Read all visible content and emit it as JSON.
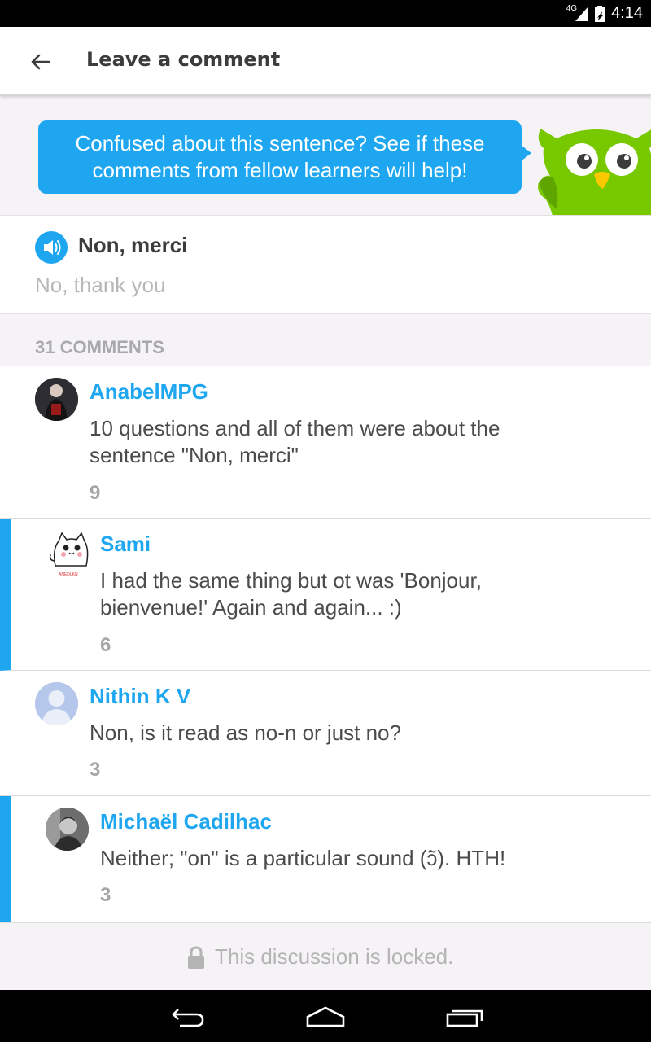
{
  "status_bar": {
    "network": "4G",
    "time": "4:14"
  },
  "app_bar": {
    "title": "Leave a comment",
    "back_icon": "arrow-left-icon"
  },
  "tip": {
    "message_line1": "Confused about this sentence? See if these",
    "message_line2": "comments from fellow learners will help!"
  },
  "sentence": {
    "text": "Non, merci",
    "translation": "No, thank you"
  },
  "comments_header": {
    "label": "31 COMMENTS"
  },
  "comments": [
    {
      "author": "AnabelMPG",
      "line1": "10 questions and all of them were about the",
      "line2": "sentence \"Non, merci\"",
      "votes": "9",
      "reply": false
    },
    {
      "author": "Sami",
      "line1": "I had the same thing but ot was 'Bonjour,",
      "line2": "bienvenue!' Again and again... :)",
      "votes": "6",
      "reply": true
    },
    {
      "author": "Nithin K V",
      "line1": "Non, is it read as no-n or just no?",
      "line2": "",
      "votes": "3",
      "reply": false
    },
    {
      "author": "Michaël Cadilhac",
      "line1": "Neither; \"on\" is a particular sound (ɔ̃). HTH!",
      "line2": "",
      "votes": "3",
      "reply": true
    }
  ],
  "avatar_caption": "ANEDLKN",
  "locked": {
    "message": "This discussion is locked."
  },
  "colors": {
    "accent": "#1ea7f0",
    "owl_green": "#78c800",
    "background": "#f5f3f6"
  }
}
